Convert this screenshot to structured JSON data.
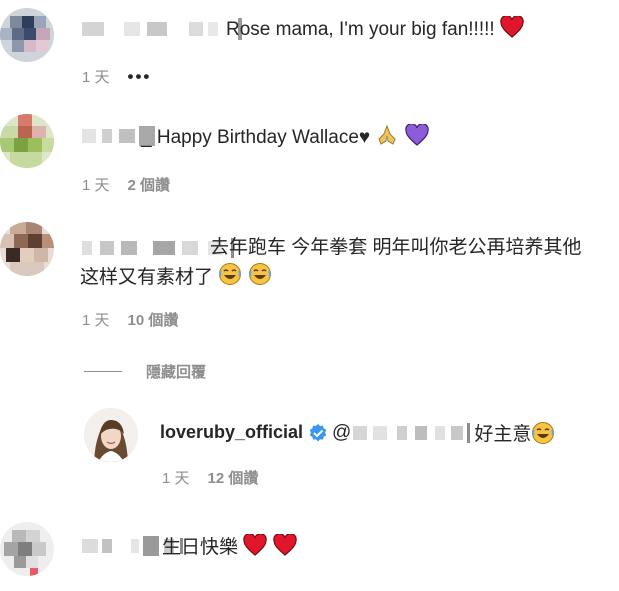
{
  "comments": [
    {
      "text": "Rose mama, I'm your big fan!!!!!",
      "time": "1 天",
      "more": "•••"
    },
    {
      "text": "_ Happy Birthday Wallace♥🙏💜",
      "text_main": "_ Happy Birthday Wallace♥",
      "time": "1 天",
      "likes": "2 個讚"
    },
    {
      "text_line1": "去年跑车 今年拳套 明年叫你老公再培养其他",
      "text_line2": "这样又有素材了",
      "time": "1 天",
      "likes": "10 個讚"
    },
    {
      "text": "生日快樂",
      "time": "",
      "likes": ""
    }
  ],
  "hide_replies": "隱藏回覆",
  "reply": {
    "username": "loveruby_official",
    "mention_prefix": "@",
    "text": "好主意",
    "time": "1 天",
    "likes": "12 個讚"
  },
  "icons": [
    "red-heart-icon",
    "folded-hands-icon",
    "purple-heart-icon",
    "laughing-tears-icon",
    "verified-badge-icon"
  ],
  "colors": {
    "text": "#262626",
    "secondary": "#8e8e8e",
    "heart": "#e0162b",
    "purple_heart": "#8e5bd9",
    "verified": "#3897f0"
  }
}
